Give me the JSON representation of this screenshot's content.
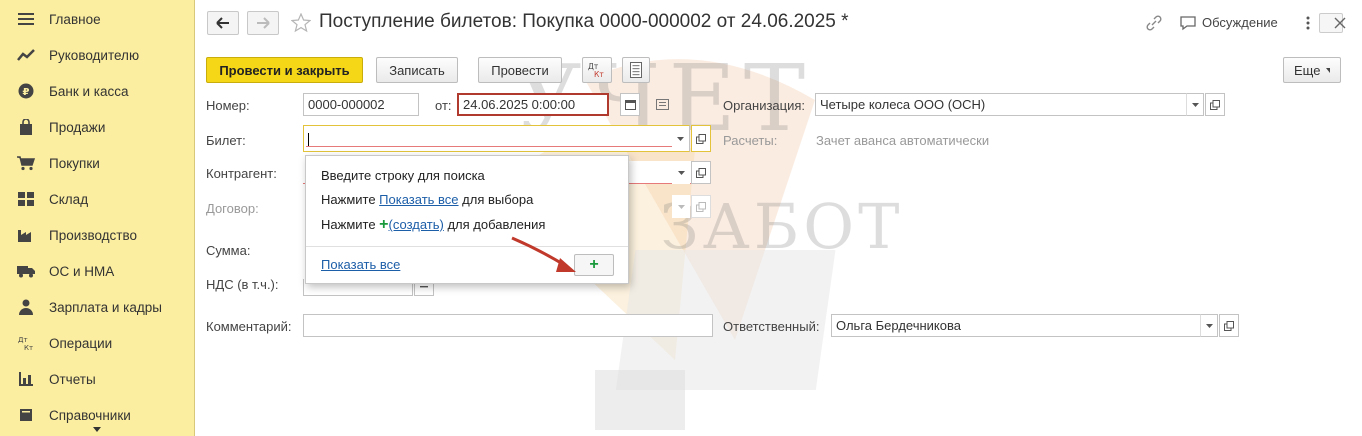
{
  "sidebar": {
    "items": [
      {
        "label": "Главное",
        "icon": "menu-icon"
      },
      {
        "label": "Руководителю",
        "icon": "trend-icon"
      },
      {
        "label": "Банк и касса",
        "icon": "coin-icon"
      },
      {
        "label": "Продажи",
        "icon": "bag-icon"
      },
      {
        "label": "Покупки",
        "icon": "cart-icon"
      },
      {
        "label": "Склад",
        "icon": "warehouse-icon"
      },
      {
        "label": "Производство",
        "icon": "factory-icon"
      },
      {
        "label": "ОС и НМА",
        "icon": "truck-icon"
      },
      {
        "label": "Зарплата и кадры",
        "icon": "person-icon"
      },
      {
        "label": "Операции",
        "icon": "dt-kt-icon"
      },
      {
        "label": "Отчеты",
        "icon": "bar-chart-icon"
      },
      {
        "label": "Справочники",
        "icon": "book-icon"
      }
    ]
  },
  "header": {
    "title": "Поступление билетов: Покупка 0000-000002 от 24.06.2025 *",
    "discussion": "Обсуждение",
    "more_label": "Еще"
  },
  "toolbar": {
    "post_close": "Провести и закрыть",
    "save": "Записать",
    "post": "Провести",
    "dtkt": "Дт Кт"
  },
  "form": {
    "number_label": "Номер:",
    "number_value": "0000-000002",
    "from_label": "от:",
    "date_value": "24.06.2025  0:00:00",
    "org_label": "Организация:",
    "org_value": "Четыре колеса ООО (ОСН)",
    "ticket_label": "Билет:",
    "ticket_value": "",
    "settlements_label": "Расчеты:",
    "settlements_value": "Зачет аванса автоматически",
    "counterparty_label": "Контрагент:",
    "contract_label": "Договор:",
    "sum_label": "Сумма:",
    "vat_label": "НДС (в т.ч.):",
    "comment_label": "Комментарий:",
    "comment_value": "",
    "responsible_label": "Ответственный:",
    "responsible_value": "Ольга Бердечникова"
  },
  "popup": {
    "line1": "Введите строку для поиска",
    "line2_pre": "Нажмите ",
    "line2_link": "Показать все",
    "line2_post": " для выбора",
    "line3_pre": "Нажмите ",
    "line3_link": "(создать)",
    "line3_post": " для добавления",
    "show_all": "Показать все",
    "create_symbol": "+"
  },
  "watermark": {
    "line1": "УЧЕТ",
    "line2": "БЕЗ ЗАБОТ"
  },
  "colors": {
    "sidebar_bg": "#fbeea0",
    "primary_button": "#f5d717",
    "link": "#1d5ea8",
    "create_plus": "#1a9a3c",
    "date_highlight": "#b03a2e"
  }
}
